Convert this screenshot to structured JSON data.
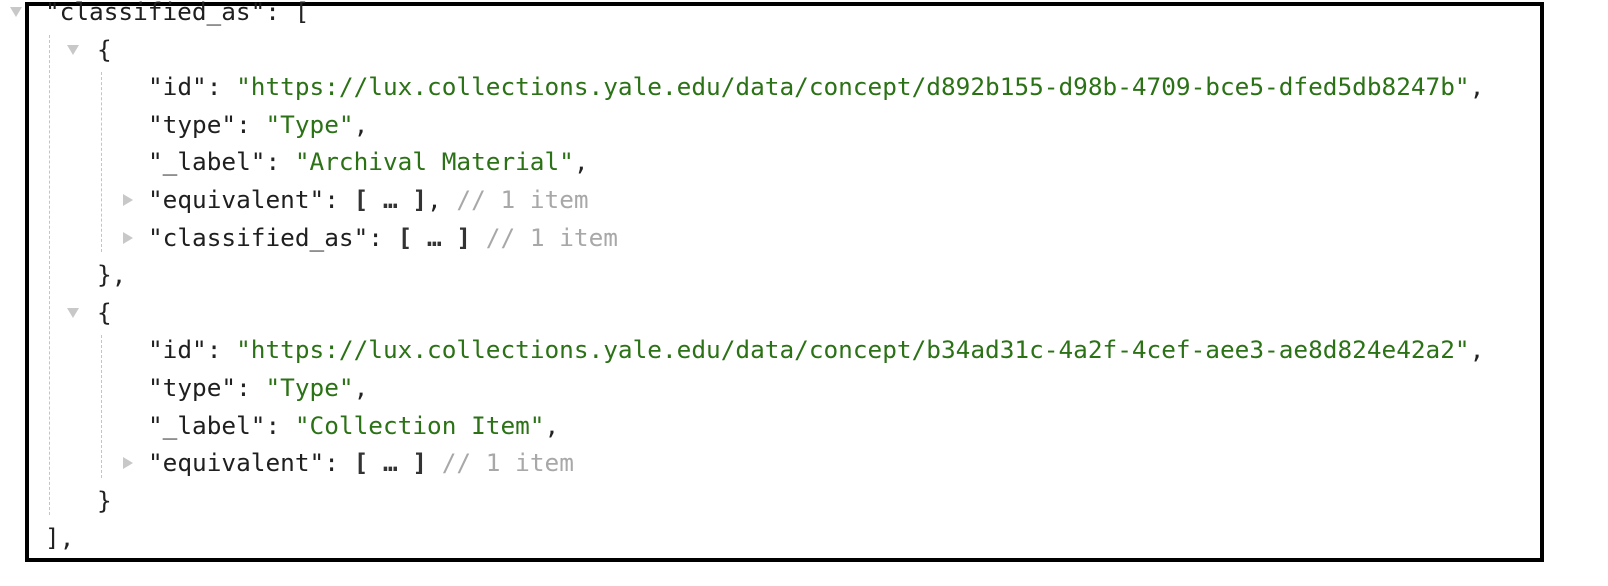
{
  "colors": {
    "key": "#1f1f1f",
    "string": "#2b7216",
    "comment": "#a8a8a8",
    "toggle": "#c8c8c8"
  },
  "lines": [
    {
      "level": 0,
      "toggle": "open",
      "parts": [
        {
          "t": "\"classified_as\"",
          "c": "k"
        },
        {
          "t": ": [",
          "c": "p"
        }
      ]
    },
    {
      "level": 1,
      "toggle": "open",
      "parts": [
        {
          "t": "{",
          "c": "p"
        }
      ]
    },
    {
      "level": 2,
      "toggle": "none",
      "parts": [
        {
          "t": "\"id\"",
          "c": "k"
        },
        {
          "t": ": ",
          "c": "p"
        },
        {
          "t": "\"https://lux.collections.yale.edu/data/concept/d892b155-d98b-4709-bce5-dfed5db8247b\"",
          "c": "s"
        },
        {
          "t": ",",
          "c": "p"
        }
      ]
    },
    {
      "level": 2,
      "toggle": "none",
      "parts": [
        {
          "t": "\"type\"",
          "c": "k"
        },
        {
          "t": ": ",
          "c": "p"
        },
        {
          "t": "\"Type\"",
          "c": "s"
        },
        {
          "t": ",",
          "c": "p"
        }
      ]
    },
    {
      "level": 2,
      "toggle": "none",
      "parts": [
        {
          "t": "\"_label\"",
          "c": "k"
        },
        {
          "t": ": ",
          "c": "p"
        },
        {
          "t": "\"Archival Material\"",
          "c": "s"
        },
        {
          "t": ",",
          "c": "p"
        }
      ]
    },
    {
      "level": 2,
      "toggle": "closed",
      "parts": [
        {
          "t": "\"equivalent\"",
          "c": "k"
        },
        {
          "t": ": ",
          "c": "p"
        },
        {
          "t": "[ … ]",
          "c": "e"
        },
        {
          "t": ", ",
          "c": "p"
        },
        {
          "t": "// 1 item",
          "c": "c"
        }
      ]
    },
    {
      "level": 2,
      "toggle": "closed",
      "parts": [
        {
          "t": "\"classified_as\"",
          "c": "k"
        },
        {
          "t": ": ",
          "c": "p"
        },
        {
          "t": "[ … ]",
          "c": "e"
        },
        {
          "t": " ",
          "c": "p"
        },
        {
          "t": "// 1 item",
          "c": "c"
        }
      ]
    },
    {
      "level": 1,
      "toggle": "none",
      "parts": [
        {
          "t": "},",
          "c": "p"
        }
      ]
    },
    {
      "level": 1,
      "toggle": "open",
      "parts": [
        {
          "t": "{",
          "c": "p"
        }
      ]
    },
    {
      "level": 2,
      "toggle": "none",
      "parts": [
        {
          "t": "\"id\"",
          "c": "k"
        },
        {
          "t": ": ",
          "c": "p"
        },
        {
          "t": "\"https://lux.collections.yale.edu/data/concept/b34ad31c-4a2f-4cef-aee3-ae8d824e42a2\"",
          "c": "s"
        },
        {
          "t": ",",
          "c": "p"
        }
      ]
    },
    {
      "level": 2,
      "toggle": "none",
      "parts": [
        {
          "t": "\"type\"",
          "c": "k"
        },
        {
          "t": ": ",
          "c": "p"
        },
        {
          "t": "\"Type\"",
          "c": "s"
        },
        {
          "t": ",",
          "c": "p"
        }
      ]
    },
    {
      "level": 2,
      "toggle": "none",
      "parts": [
        {
          "t": "\"_label\"",
          "c": "k"
        },
        {
          "t": ": ",
          "c": "p"
        },
        {
          "t": "\"Collection Item\"",
          "c": "s"
        },
        {
          "t": ",",
          "c": "p"
        }
      ]
    },
    {
      "level": 2,
      "toggle": "closed",
      "parts": [
        {
          "t": "\"equivalent\"",
          "c": "k"
        },
        {
          "t": ": ",
          "c": "p"
        },
        {
          "t": "[ … ]",
          "c": "e"
        },
        {
          "t": " ",
          "c": "p"
        },
        {
          "t": "// 1 item",
          "c": "c"
        }
      ]
    },
    {
      "level": 1,
      "toggle": "none",
      "parts": [
        {
          "t": "}",
          "c": "p"
        }
      ]
    },
    {
      "level": 0,
      "toggle": "none",
      "parts": [
        {
          "t": "],",
          "c": "p"
        }
      ]
    }
  ]
}
